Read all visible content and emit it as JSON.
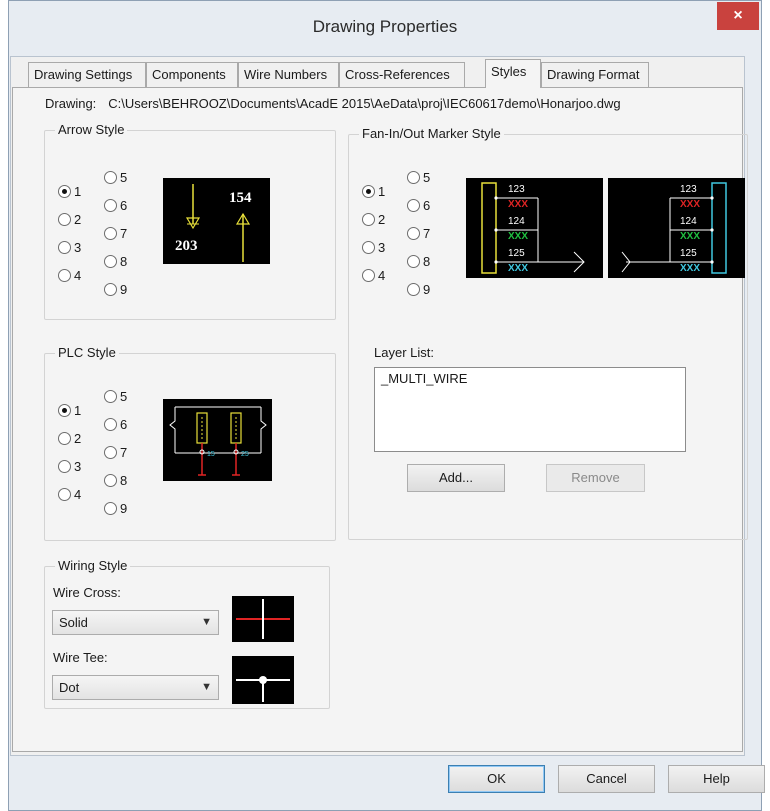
{
  "dialog": {
    "title": "Drawing Properties",
    "close_glyph": "×"
  },
  "tabs": [
    {
      "label": "Drawing Settings"
    },
    {
      "label": "Components"
    },
    {
      "label": "Wire Numbers"
    },
    {
      "label": "Cross-References"
    },
    {
      "label": "Styles",
      "active": true
    },
    {
      "label": "Drawing Format"
    }
  ],
  "drawing": {
    "label": "Drawing:",
    "path": "C:\\Users\\BEHROOZ\\Documents\\AcadE 2015\\AeData\\proj\\IEC60617demo\\Honarjoo.dwg"
  },
  "arrow_style": {
    "title": "Arrow Style",
    "options": [
      "1",
      "2",
      "3",
      "4",
      "5",
      "6",
      "7",
      "8",
      "9"
    ],
    "selected": "1",
    "preview": {
      "label_top": "154",
      "label_bottom": "203"
    }
  },
  "fan_style": {
    "title": "Fan-In/Out Marker Style",
    "options": [
      "1",
      "2",
      "3",
      "4",
      "5",
      "6",
      "7",
      "8",
      "9"
    ],
    "selected": "1",
    "preview": {
      "numbers": [
        "123",
        "124",
        "125"
      ],
      "tags": [
        "XXX",
        "XXX",
        "XXX"
      ]
    }
  },
  "plc_style": {
    "title": "PLC Style",
    "options": [
      "1",
      "2",
      "3",
      "4",
      "5",
      "6",
      "7",
      "8",
      "9"
    ],
    "selected": "1",
    "preview": {
      "pin_labels": [
        "15",
        "25"
      ]
    }
  },
  "layer_list": {
    "title": "Layer List:",
    "items": [
      "_MULTI_WIRE"
    ],
    "add_label": "Add...",
    "remove_label": "Remove"
  },
  "wiring_style": {
    "title": "Wiring Style",
    "wire_cross_label": "Wire Cross:",
    "wire_cross_value": "Solid",
    "wire_tee_label": "Wire Tee:",
    "wire_tee_value": "Dot",
    "dropdown_glyph": "▼"
  },
  "footer": {
    "ok_label": "OK",
    "cancel_label": "Cancel",
    "help_label": "Help"
  },
  "colors": {
    "close": "#c9423e",
    "preview_bg": "#000000",
    "yellow": "#e8e03a",
    "red": "#e02424",
    "green": "#20c040",
    "cyan": "#40c8e0",
    "white": "#ffffff"
  }
}
